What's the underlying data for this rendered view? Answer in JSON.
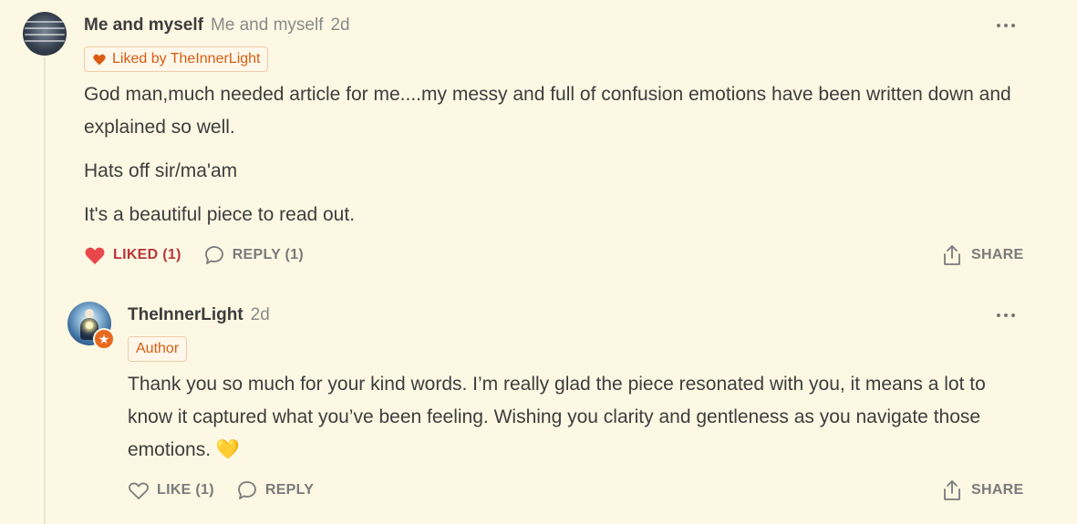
{
  "comment": {
    "author": "Me and myself",
    "handle": "Me and myself",
    "time": "2d",
    "liked_by_label": "Liked by TheInnerLight",
    "paragraphs": [
      "God man,much needed article for me....my messy and full of confusion emotions have been written down and explained so well.",
      "Hats off sir/ma'am",
      "It's a beautiful piece to read out."
    ],
    "like_label": "LIKED (1)",
    "reply_label": "REPLY (1)",
    "share_label": "SHARE",
    "colors": {
      "liked": "#e8474c",
      "accent": "#d95b12"
    }
  },
  "reply": {
    "author": "TheInnerLight",
    "time": "2d",
    "badge_label": "Author",
    "text": "Thank you so much for your kind words. I’m really glad the piece resonated with you, it means a lot to know it captured what you’ve been feeling. Wishing you clarity and gentleness as you navigate those emotions. 💛",
    "like_label": "LIKE (1)",
    "reply_label": "REPLY",
    "share_label": "SHARE"
  },
  "icons": {
    "more": "more-horizontal-icon",
    "heart": "heart-icon",
    "comment": "comment-bubble-icon",
    "share": "share-upload-icon",
    "author_badge": "star-badge-icon"
  }
}
